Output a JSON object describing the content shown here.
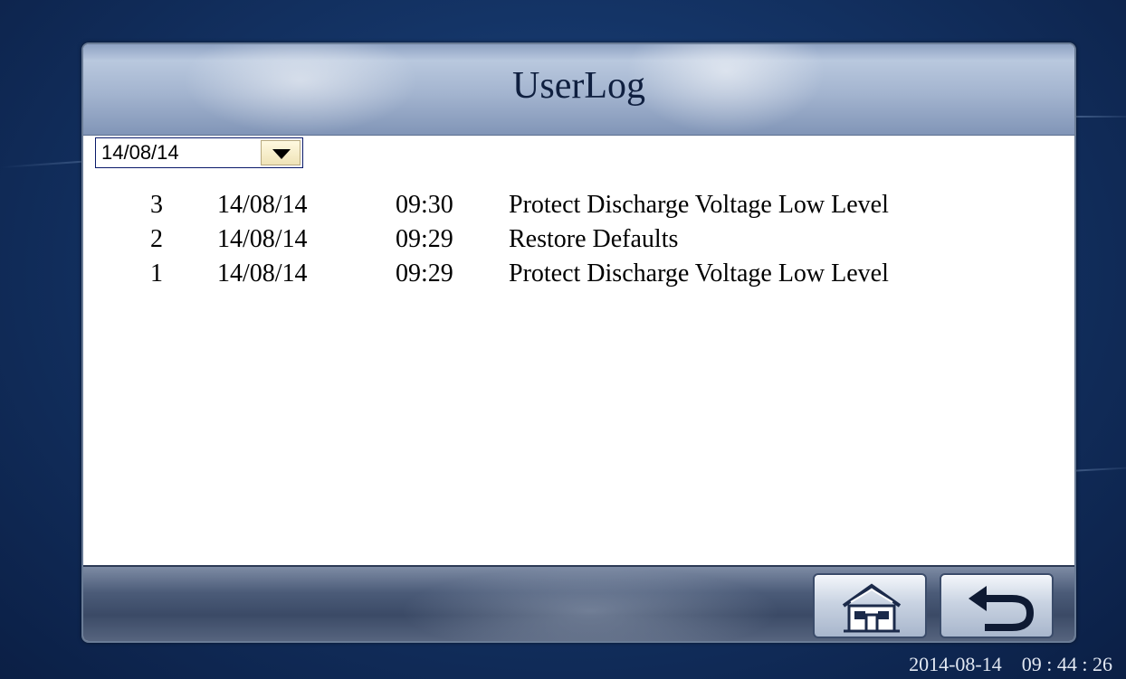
{
  "window": {
    "title": "UserLog"
  },
  "date_filter": {
    "selected": "14/08/14"
  },
  "log_entries": [
    {
      "num": "3",
      "date": "14/08/14",
      "time": "09:30",
      "event": "Protect Discharge Voltage Low Level"
    },
    {
      "num": "2",
      "date": "14/08/14",
      "time": "09:29",
      "event": "Restore Defaults"
    },
    {
      "num": "1",
      "date": "14/08/14",
      "time": "09:29",
      "event": "Protect Discharge Voltage Low Level"
    }
  ],
  "toolbar": {
    "home_icon": "home-icon",
    "back_icon": "back-arrow-icon"
  },
  "status": {
    "date": "2014-08-14",
    "time": "09 : 44 : 26"
  },
  "colors": {
    "background": "#143466",
    "title_text": "#0f1f3f",
    "dropdown_button": "#efe3b8"
  }
}
